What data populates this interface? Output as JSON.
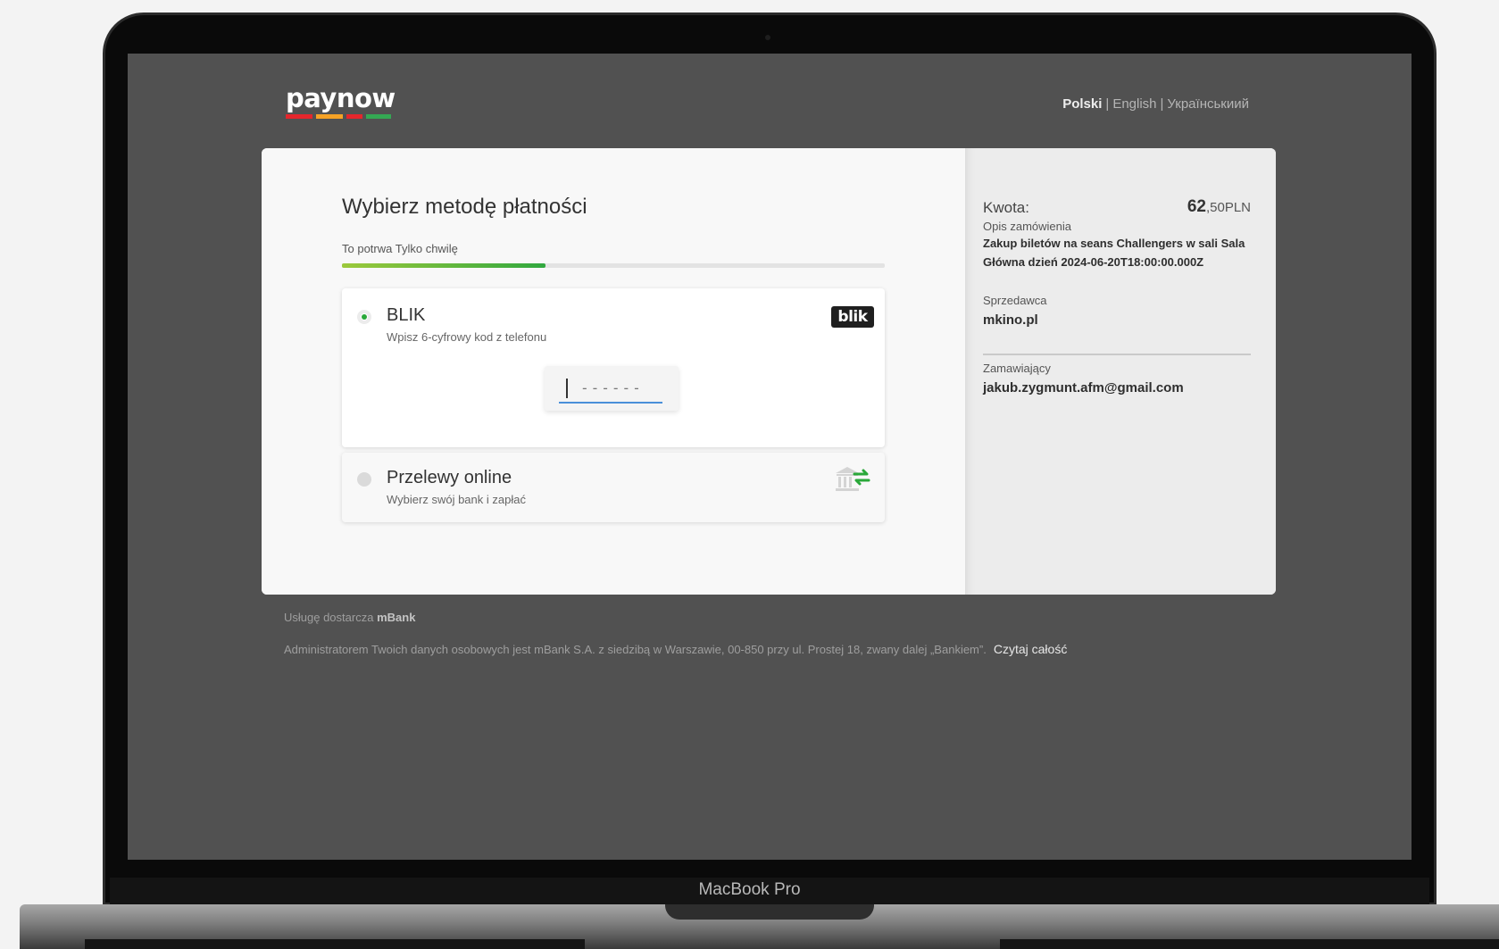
{
  "brand": {
    "logo_text": "paynow",
    "logo_bar_colors": [
      "#e4262c",
      "#e4262c",
      "#f6a225",
      "#e4262c",
      "#34a853",
      "#34a853"
    ]
  },
  "languages": {
    "active": "Polski",
    "options": [
      "English",
      "Українськиий"
    ]
  },
  "main": {
    "title": "Wybierz metodę płatności",
    "progress_label": "To potrwa Tylko chwilę",
    "progress_fraction": 0.375
  },
  "methods": {
    "blik": {
      "name": "BLIK",
      "description": "Wpisz 6-cyfrowy kod z telefonu",
      "logo_text": "blik",
      "code_placeholder": "------",
      "selected": true
    },
    "online": {
      "name": "Przelewy online",
      "description": "Wybierz swój bank i zapłać",
      "selected": false
    }
  },
  "summary": {
    "amount_label": "Kwota:",
    "amount_int": "62",
    "amount_dec": ",50",
    "currency": "PLN",
    "order_label": "Opis zamówienia",
    "order_value": "Zakup biletów na seans Challengers w sali Sala Główna dzień 2024-06-20T18:00:00.000Z",
    "seller_label": "Sprzedawca",
    "seller_value": "mkino.pl",
    "buyer_label": "Zamawiający",
    "buyer_value": "jakub.zygmunt.afm@gmail.com"
  },
  "footer": {
    "provider_prefix": "Usługę dostarcza",
    "provider_name": "mBank",
    "privacy_text": "Administratorem Twoich danych osobowych jest mBank S.A. z siedzibą w Warszawie, 00-850 przy ul. Prostej 18, zwany dalej „Bankiem”.",
    "read_more": "Czytaj całość"
  },
  "device": {
    "model_label": "MacBook Pro"
  },
  "colors": {
    "accent_green": "#2aa83a",
    "screen_bg": "#515151",
    "input_underline": "#4a90d9"
  }
}
